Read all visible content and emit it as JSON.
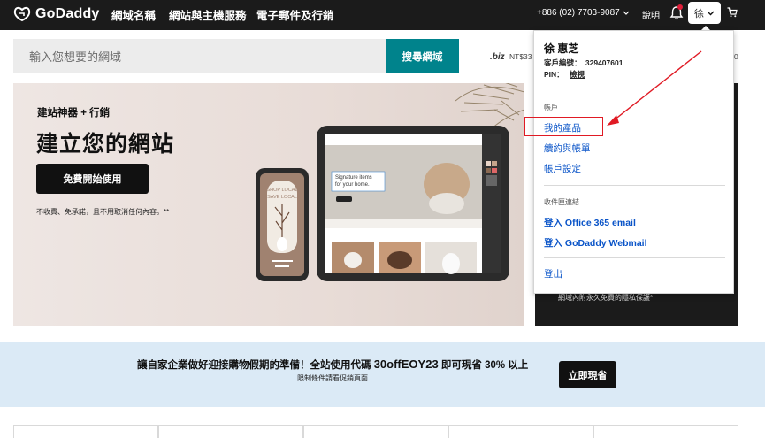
{
  "nav": {
    "logo": "GoDaddy",
    "links": [
      "網域名稱",
      "網站與主機服務",
      "電子郵件及行銷"
    ],
    "phone": "+886 (02) 7703-9087",
    "help": "說明",
    "account_initial": "徐"
  },
  "search": {
    "placeholder": "輸入您想要的網域",
    "button": "搜尋網域",
    "tld": ".biz",
    "price": "NT$33",
    "price_right": "0"
  },
  "hero": {
    "kicker": "建站神器 + 行銷",
    "title": "建立您的網站",
    "cta": "免費開始使用",
    "disclaimer": "不收費、免承諾，且不用取消任何內容。**",
    "mockup_tagline": "Signature items for your home.",
    "mockup_phone_text": "SHOP LOCAL SAVE LOCAL"
  },
  "promo": {
    "text": "網域內附永久免費的隱私保護*"
  },
  "account_menu": {
    "name": "徐 惠芝",
    "customer_label": "客戶編號：",
    "customer_id": "329407601",
    "pin_label": "PIN：",
    "pin_link": "檢視",
    "section_account": "帳戶",
    "account_links": [
      "我的產品",
      "續約與帳單",
      "帳戶設定"
    ],
    "section_inbox": "收件匣連結",
    "inbox_links": [
      "登入 Office 365 email",
      "登入 GoDaddy Webmail"
    ],
    "sign_out": "登出"
  },
  "banner": {
    "text_before": "讓自家企業做好迎接購物假期的準備！全站使用代碼 ",
    "code": "30offEOY23",
    "text_after": " 即可現省 30% 以上",
    "sub": "限制條件請看促銷頁面",
    "button": "立即現省"
  },
  "colors": {
    "nav_bg": "#1b1b1b",
    "search_btn": "#00838c",
    "link": "#0a54c8",
    "annotation": "#e01a24",
    "banner_bg": "#dbeaf6"
  }
}
